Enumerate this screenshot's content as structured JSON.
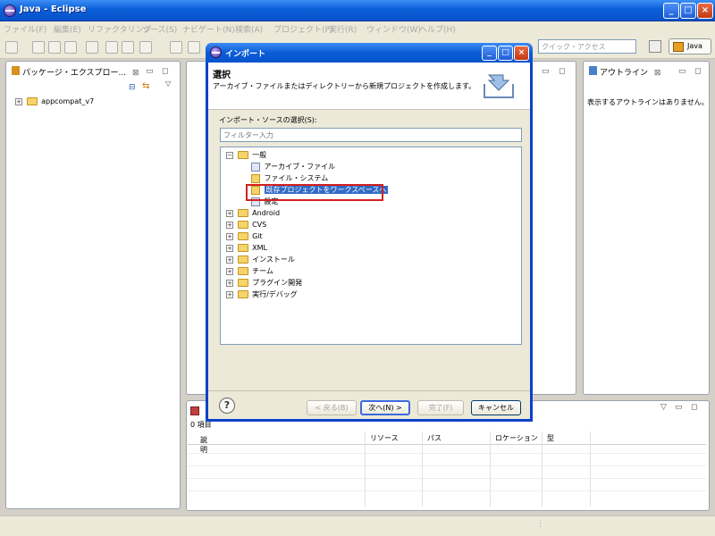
{
  "window": {
    "title": "Java - Eclipse"
  },
  "menu": {
    "items": [
      "ファイル(F)",
      "編集(E)",
      "リファクタリング",
      "ソース(S)",
      "ナビゲート(N)",
      "検索(A)",
      "プロジェクト(P)",
      "実行(R)",
      "ウィンドウ(W)",
      "ヘルプ(H)"
    ]
  },
  "toolbar": {
    "quick_access_placeholder": "クイック・アクセス",
    "perspective_label": "Java"
  },
  "package_explorer": {
    "tab_label": "パッケージ・エクスプロー...",
    "tab_close": "⊠",
    "items": [
      {
        "label": "appcompat_v7",
        "expander": "+"
      }
    ]
  },
  "outline": {
    "tab_label": "アウトライン",
    "tab_close": "⊠",
    "empty_message": "表示するアウトラインはありません。"
  },
  "problems": {
    "count_label": "0 項目",
    "columns": [
      "説明",
      "リソース",
      "パス",
      "ロケーション",
      "型"
    ],
    "sort_indicator": "▲"
  },
  "dialog": {
    "title": "インポート",
    "heading": "選択",
    "description": "アーカイブ・ファイルまたはディレクトリーから新規プロジェクトを作成します。",
    "source_label": "インポート・ソースの選択(S):",
    "filter_placeholder": "フィルター入力",
    "tree": {
      "general": {
        "label": "一般",
        "expander": "−"
      },
      "general_children": [
        "アーカイブ・ファイル",
        "ファイル・システム",
        "既存プロジェクトをワークスペースへ",
        "設定"
      ],
      "categories": [
        "Android",
        "CVS",
        "Git",
        "XML",
        "インストール",
        "チーム",
        "プラグイン開発",
        "実行/デバッグ"
      ],
      "collapsed_expander": "+"
    },
    "buttons": {
      "help": "?",
      "back": "< 戻る(B)",
      "next": "次へ(N) >",
      "finish": "完了(F)",
      "cancel": "キャンセル"
    }
  }
}
